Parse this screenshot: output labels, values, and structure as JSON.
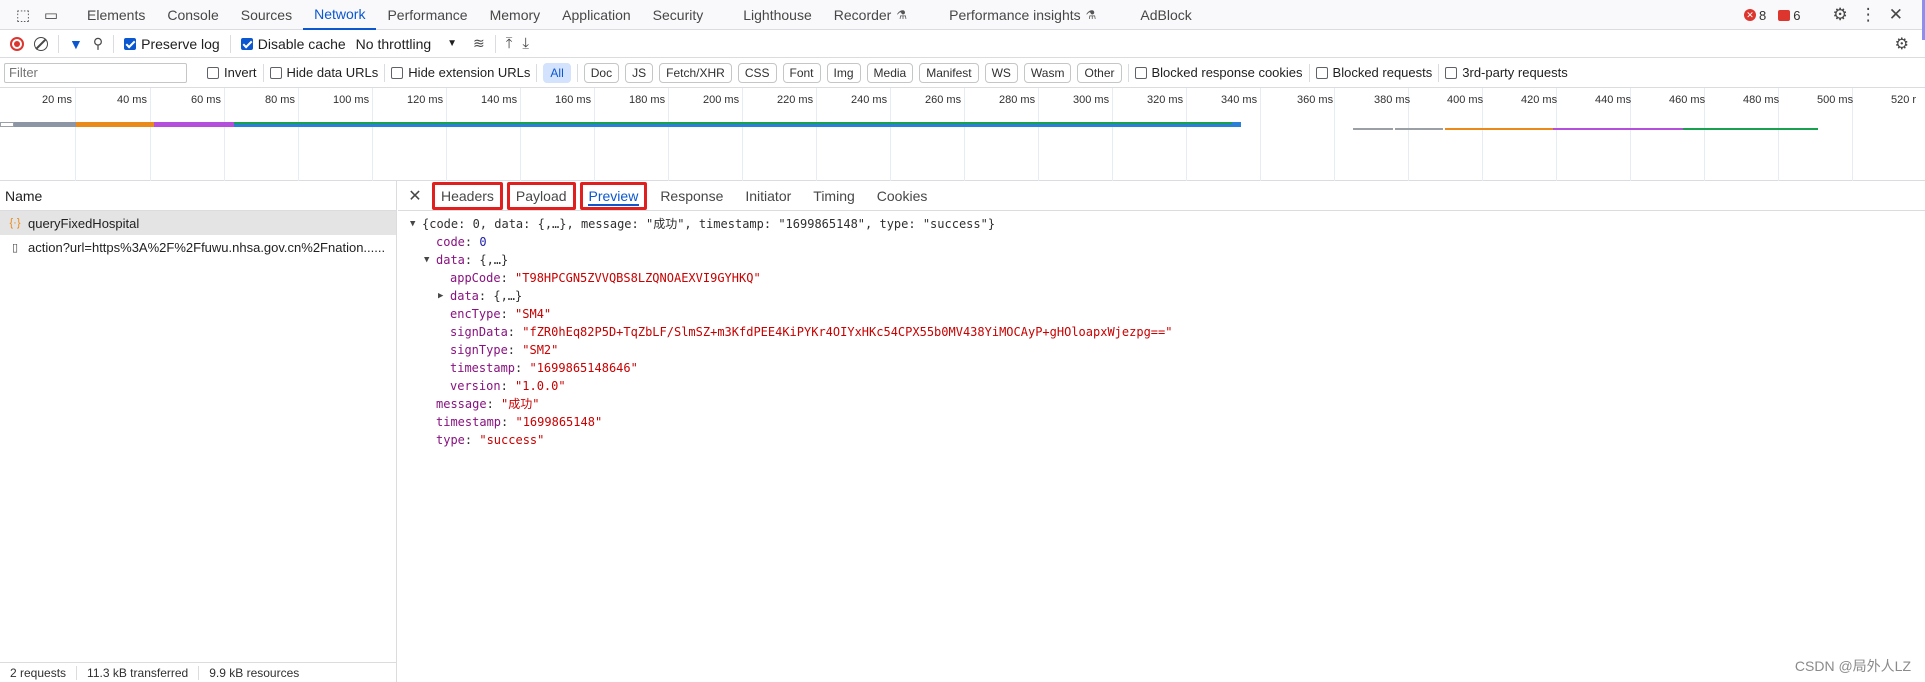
{
  "tabs": [
    "Elements",
    "Console",
    "Sources",
    "Network",
    "Performance",
    "Memory",
    "Application",
    "Security",
    "Lighthouse",
    "Recorder",
    "Performance insights",
    "AdBlock"
  ],
  "errors_count": "8",
  "issues_count": "6",
  "toolbar": {
    "preserve_log": "Preserve log",
    "disable_cache": "Disable cache",
    "throttling": "No throttling"
  },
  "filter": {
    "placeholder": "Filter",
    "invert": "Invert",
    "hide_data_urls": "Hide data URLs",
    "hide_extension_urls": "Hide extension URLs",
    "types": [
      "All",
      "Doc",
      "JS",
      "Fetch/XHR",
      "CSS",
      "Font",
      "Img",
      "Media",
      "Manifest",
      "WS",
      "Wasm",
      "Other"
    ],
    "blocked_response_cookies": "Blocked response cookies",
    "blocked_requests": "Blocked requests",
    "third_party": "3rd-party requests"
  },
  "timeline_ticks": [
    "20 ms",
    "40 ms",
    "60 ms",
    "80 ms",
    "100 ms",
    "120 ms",
    "140 ms",
    "160 ms",
    "180 ms",
    "200 ms",
    "220 ms",
    "240 ms",
    "260 ms",
    "280 ms",
    "300 ms",
    "320 ms",
    "340 ms",
    "360 ms",
    "380 ms",
    "400 ms",
    "420 ms",
    "440 ms",
    "460 ms",
    "480 ms",
    "500 ms",
    "520 r"
  ],
  "requests": {
    "header": "Name",
    "items": [
      "queryFixedHospital",
      "action?url=https%3A%2F%2Ffuwu.nhsa.gov.cn%2Fnation......"
    ]
  },
  "footer": {
    "requests": "2 requests",
    "transferred": "11.3 kB transferred",
    "resources": "9.9 kB resources"
  },
  "detail_tabs": [
    "Headers",
    "Payload",
    "Preview",
    "Response",
    "Initiator",
    "Timing",
    "Cookies"
  ],
  "preview": {
    "summary": "{code: 0, data: {,…}, message: \"成功\", timestamp: \"1699865148\", type: \"success\"}",
    "code_key": "code",
    "code_val": "0",
    "data_key": "data",
    "data_val": "{,…}",
    "appCode_key": "appCode",
    "appCode_val": "\"T98HPCGN5ZVVQBS8LZQNOAEXVI9GYHKQ\"",
    "inner_data_key": "data",
    "inner_data_val": "{,…}",
    "encType_key": "encType",
    "encType_val": "\"SM4\"",
    "signData_key": "signData",
    "signData_val": "\"fZR0hEq82P5D+TqZbLF/SlmSZ+m3KfdPEE4KiPYKr4OIYxHKc54CPX55b0MV438YiMOCAyP+gHOloapxWjezpg==\"",
    "signType_key": "signType",
    "signType_val": "\"SM2\"",
    "inner_ts_key": "timestamp",
    "inner_ts_val": "\"1699865148646\"",
    "version_key": "version",
    "version_val": "\"1.0.0\"",
    "message_key": "message",
    "message_val": "\"成功\"",
    "ts_key": "timestamp",
    "ts_val": "\"1699865148\"",
    "type_key": "type",
    "type_val": "\"success\""
  },
  "watermark": "CSDN @局外人LZ",
  "colors": {
    "accent": "#0b57d0",
    "highlight_box": "#e0201e",
    "json_key": "#881280",
    "json_string": "#c80000",
    "json_number": "#1a1aa6"
  }
}
